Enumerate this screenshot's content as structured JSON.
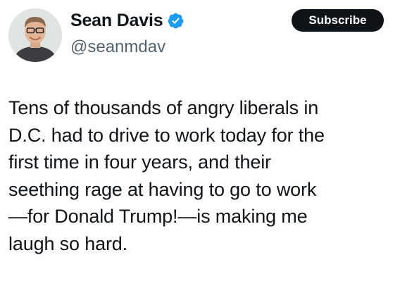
{
  "author": {
    "display_name": "Sean Davis",
    "handle": "@seanmdav",
    "verified": true,
    "verified_color": "#1d9bf0"
  },
  "subscribe_button": {
    "label": "Subscribe",
    "background": "#0f1419",
    "text_color": "#ffffff"
  },
  "tweet": {
    "lines": [
      "Tens of thousands of angry liberals in",
      "D.C. had to drive to work today for the",
      "first time in four years, and their",
      "seething rage at having to go to work",
      "—for Donald Trump!—is making me",
      "laugh so hard."
    ]
  },
  "icons": {
    "avatar": "profile-photo",
    "verified": "verified-badge-icon"
  }
}
